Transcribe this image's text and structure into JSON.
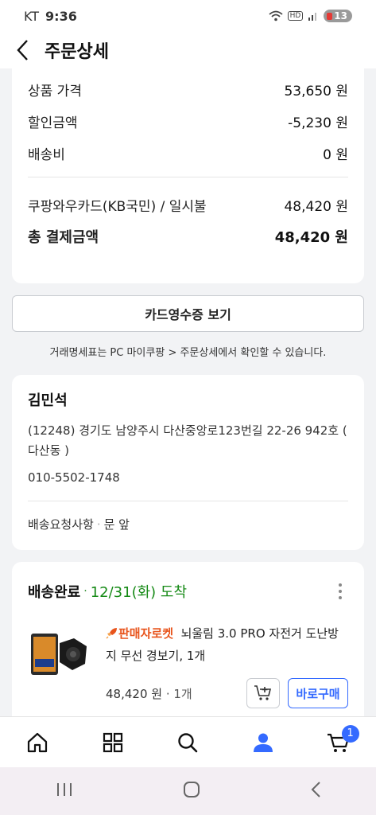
{
  "status_bar": {
    "carrier": "KT",
    "time": "9:36",
    "hd": "HD",
    "battery": "13"
  },
  "header": {
    "title": "주문상세"
  },
  "payment": {
    "rows": [
      {
        "label": "상품 가격",
        "value": "53,650 원"
      },
      {
        "label": "할인금액",
        "value": "-5,230 원"
      },
      {
        "label": "배송비",
        "value": "0 원"
      }
    ],
    "method": {
      "label": "쿠팡와우카드(KB국민) / 일시불",
      "value": "48,420 원"
    },
    "total": {
      "label": "총 결제금액",
      "value": "48,420 원"
    }
  },
  "receipt_button": "카드영수증 보기",
  "notice": "거래명세표는 PC 마이쿠팡 > 주문상세에서 확인할 수 있습니다.",
  "address": {
    "name": "김민석",
    "line1": "(12248) 경기도 남양주시 다산중앙로123번길 22-26 942호 (",
    "line2": "다산동 )",
    "phone": "010-5502-1748",
    "request_label": "배송요청사항",
    "request_value": "문 앞"
  },
  "shipment": {
    "status": "배송완료",
    "date": "12/31(화) 도착",
    "rocket_label": "판매자로켓",
    "product_title": "뇌울림 3.0 PRO 자전거 도난방지 무선 경보기, 1개",
    "price": "48,420 원",
    "quantity": "1개",
    "buy_button": "바로구매"
  },
  "bottom_nav": {
    "cart_badge": "1"
  },
  "colors": {
    "accent": "#346aff",
    "delivered": "#168a16",
    "rocket": "#e8541c"
  }
}
